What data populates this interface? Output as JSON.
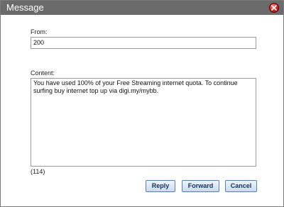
{
  "window": {
    "title": "Message"
  },
  "form": {
    "from_label": "From:",
    "from_value": "200",
    "content_label": "Content:",
    "content_value": "You have used 100% of your Free Streaming internet quota. To continue surfing buy internet top up via digi.my/mybb.",
    "char_count": "(114)"
  },
  "buttons": {
    "reply": "Reply",
    "forward": "Forward",
    "cancel": "Cancel"
  }
}
